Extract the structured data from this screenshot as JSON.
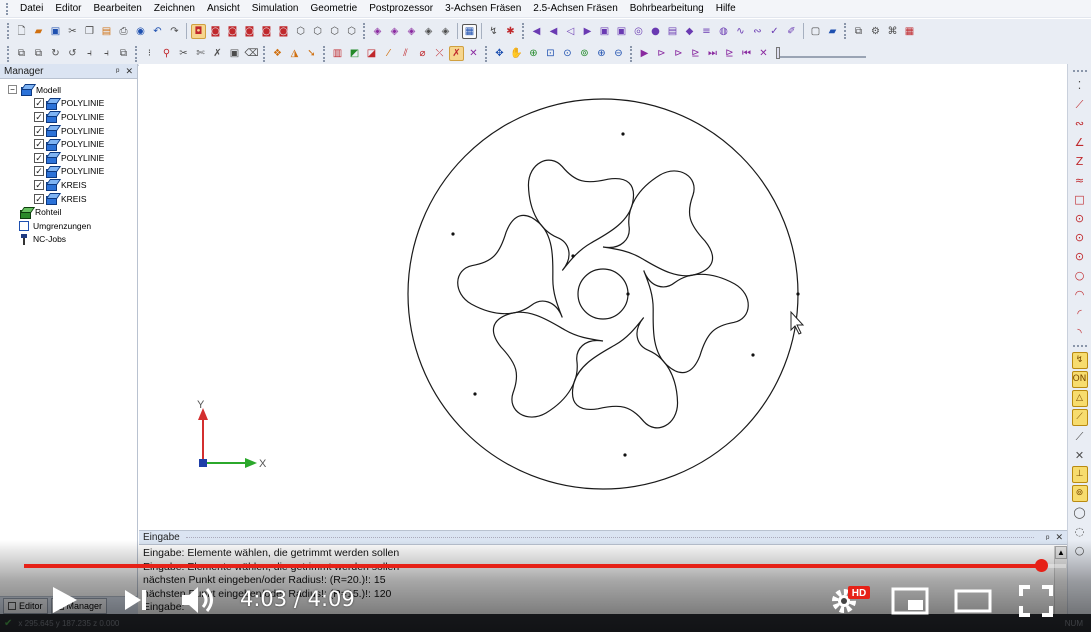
{
  "menu": {
    "items": [
      "Datei",
      "Editor",
      "Bearbeiten",
      "Zeichnen",
      "Ansicht",
      "Simulation",
      "Geometrie",
      "Postprozessor",
      "3-Achsen Fräsen",
      "2.5-Achsen Fräsen",
      "Bohrbearbeitung",
      "Hilfe"
    ]
  },
  "manager": {
    "title": "Manager",
    "pin": "ᵖ",
    "close": "✕",
    "tree": {
      "root": "Modell",
      "children": [
        "POLYLINIE",
        "POLYLINIE",
        "POLYLINIE",
        "POLYLINIE",
        "POLYLINIE",
        "POLYLINIE",
        "KREIS",
        "KREIS"
      ],
      "rohteil": "Rohteil",
      "umgrenzungen": "Umgrenzungen",
      "ncjobs": "NC-Jobs"
    },
    "tabs": [
      "Editor",
      "Manager"
    ]
  },
  "canvas": {
    "axis_x_label": "X",
    "axis_y_label": "Y"
  },
  "eingabe": {
    "title": "Eingabe",
    "lines": [
      "Eingabe: Elemente wählen, die getrimmt werden sollen",
      "Eingabe: Elemente wählen, die getrimmt werden sollen",
      "nächsten Punkt eingeben/oder Radius!: (R=20.)!: 15",
      "nächsten Punkt eingeben/oder Radius!: (R=15.)!: 120",
      "Eingabe:"
    ]
  },
  "statusbar": {
    "coords": "x 295.645   y 187.235   z 0.000",
    "mode": "NUM"
  },
  "video": {
    "time": "4:03 / 4:09",
    "progress": 0.976,
    "hd_badge": "HD",
    "accent": "#e62117"
  }
}
